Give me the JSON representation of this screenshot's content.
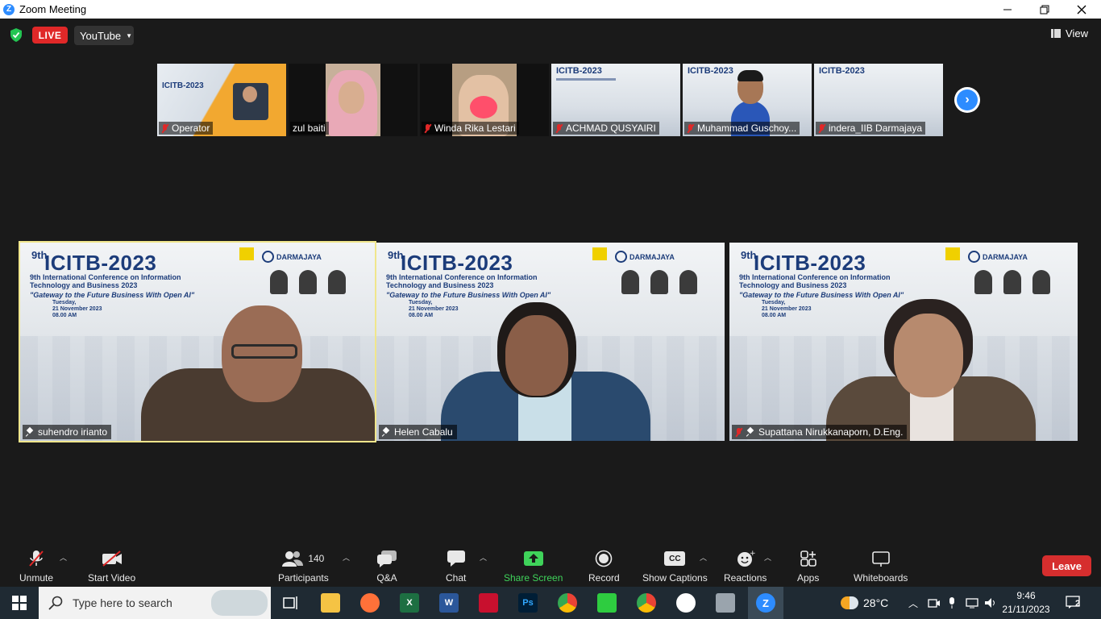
{
  "window": {
    "title": "Zoom Meeting"
  },
  "stage": {
    "live_label": "LIVE",
    "stream_target": "YouTube",
    "view_label": "View"
  },
  "thumbnails": [
    {
      "name": "Operator",
      "muted": true
    },
    {
      "name": "zul baiti",
      "muted": false
    },
    {
      "name": "Winda Rika Lestari",
      "muted": true
    },
    {
      "name": "ACHMAD QUSYAIRI",
      "muted": true
    },
    {
      "name": "Muhammad Guschoy...",
      "muted": true
    },
    {
      "name": "indera_IIB Darmajaya",
      "muted": true
    }
  ],
  "banner": {
    "sup": "9th",
    "title": "ICITB-2023",
    "subtitle": "9th International Conference on Information Technology and Business 2023",
    "theme": "\"Gateway to the Future Business With Open AI\"",
    "day": "Tuesday,",
    "date": "21 November 2023",
    "time": "08.00 AM",
    "org": "DARMAJAYA"
  },
  "tiles": [
    {
      "name": "suhendro irianto",
      "active": true,
      "muted": false
    },
    {
      "name": "Helen Cabalu",
      "active": false,
      "muted": false
    },
    {
      "name": "Supattana Nirukkanaporn, D.Eng.",
      "active": false,
      "muted": true
    }
  ],
  "toolbar": {
    "unmute": "Unmute",
    "start_video": "Start Video",
    "participants": "Participants",
    "participants_count": "140",
    "qa": "Q&A",
    "chat": "Chat",
    "share_screen": "Share Screen",
    "record": "Record",
    "captions": "Show Captions",
    "reactions": "Reactions",
    "apps": "Apps",
    "whiteboards": "Whiteboards",
    "leave": "Leave"
  },
  "taskbar": {
    "search_placeholder": "Type here to search",
    "temperature": "28°C",
    "time": "9:46",
    "date": "21/11/2023",
    "notifications": "2"
  },
  "colors": {
    "accent": "#2d8cff",
    "live": "#e02828",
    "leave": "#d62e2e",
    "share_green": "#3fd35a",
    "active_speaker": "#f0e68c"
  }
}
